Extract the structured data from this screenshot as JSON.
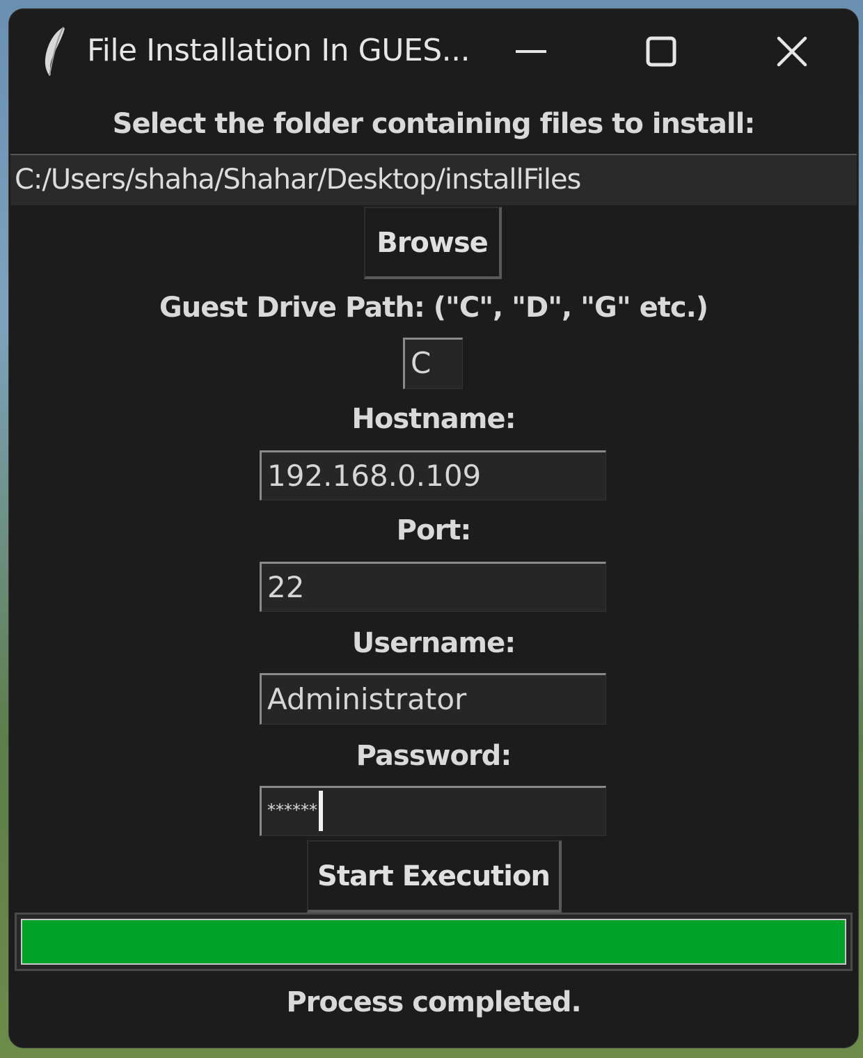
{
  "window": {
    "title": "File Installation In GUES...",
    "icon": "feather-icon"
  },
  "controls": {
    "minimize_icon": "minimize-icon",
    "maximize_icon": "maximize-icon",
    "close_icon": "close-icon"
  },
  "folder": {
    "label": "Select the folder containing files to install:",
    "path": "C:/Users/shaha/Shahar/Desktop/installFiles",
    "browse_label": "Browse"
  },
  "guest_drive": {
    "label": "Guest Drive Path: (\"C\", \"D\", \"G\" etc.)",
    "value": "C"
  },
  "hostname": {
    "label": "Hostname:",
    "value": "192.168.0.109"
  },
  "port": {
    "label": "Port:",
    "value": "22"
  },
  "username": {
    "label": "Username:",
    "value": "Administrator"
  },
  "password": {
    "label": "Password:",
    "masked_value": "******"
  },
  "actions": {
    "start_label": "Start Execution"
  },
  "progress": {
    "percent": 100,
    "color": "#00a32a"
  },
  "status": {
    "text": "Process completed."
  },
  "theme": {
    "background": "#1c1c1c",
    "text": "#d9d9d9"
  }
}
